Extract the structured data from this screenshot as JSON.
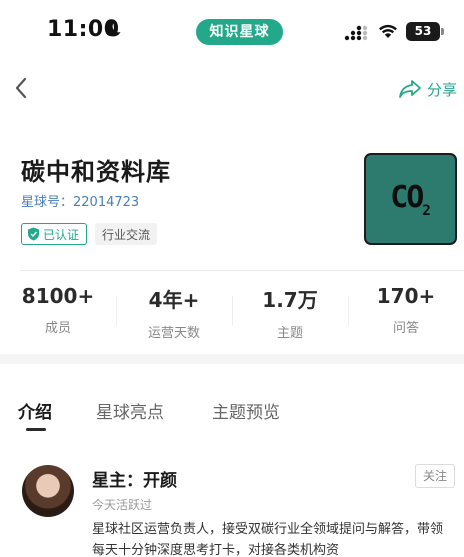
{
  "status_bar": {
    "time": "11:00",
    "app_pill": "知识星球",
    "battery": "53",
    "icons": [
      "moon-icon",
      "signal-icon",
      "wifi-icon",
      "battery-icon"
    ]
  },
  "nav": {
    "back_icon": "chevron-left-icon",
    "share_label": "分享",
    "share_icon": "share-arrow-icon"
  },
  "group": {
    "title": "碳中和资料库",
    "id_text": "星球号：22014723",
    "verified_label": "已认证",
    "tag": "行业交流",
    "avatar_text": "CO",
    "avatar_sub": "2"
  },
  "stats": [
    {
      "value": "8100+",
      "label": "成员"
    },
    {
      "value": "4年+",
      "label": "运营天数"
    },
    {
      "value": "1.7万",
      "label": "主题"
    },
    {
      "value": "170+",
      "label": "问答"
    }
  ],
  "tabs": [
    {
      "label": "介绍",
      "active": true
    },
    {
      "label": "星球亮点",
      "active": false
    },
    {
      "label": "主题预览",
      "active": false
    }
  ],
  "owner": {
    "name": "星主：开颜",
    "active_text": "今天活跃过",
    "follow_label": "关注",
    "bio": "星球社区运营负责人，接受双碳行业全领域提问与解答，带领每天十分钟深度思考打卡，对接各类机构资"
  },
  "colors": {
    "brand": "#23a98a",
    "avatar_bg": "#2d7a6e",
    "id_text": "#4a7fb3"
  }
}
